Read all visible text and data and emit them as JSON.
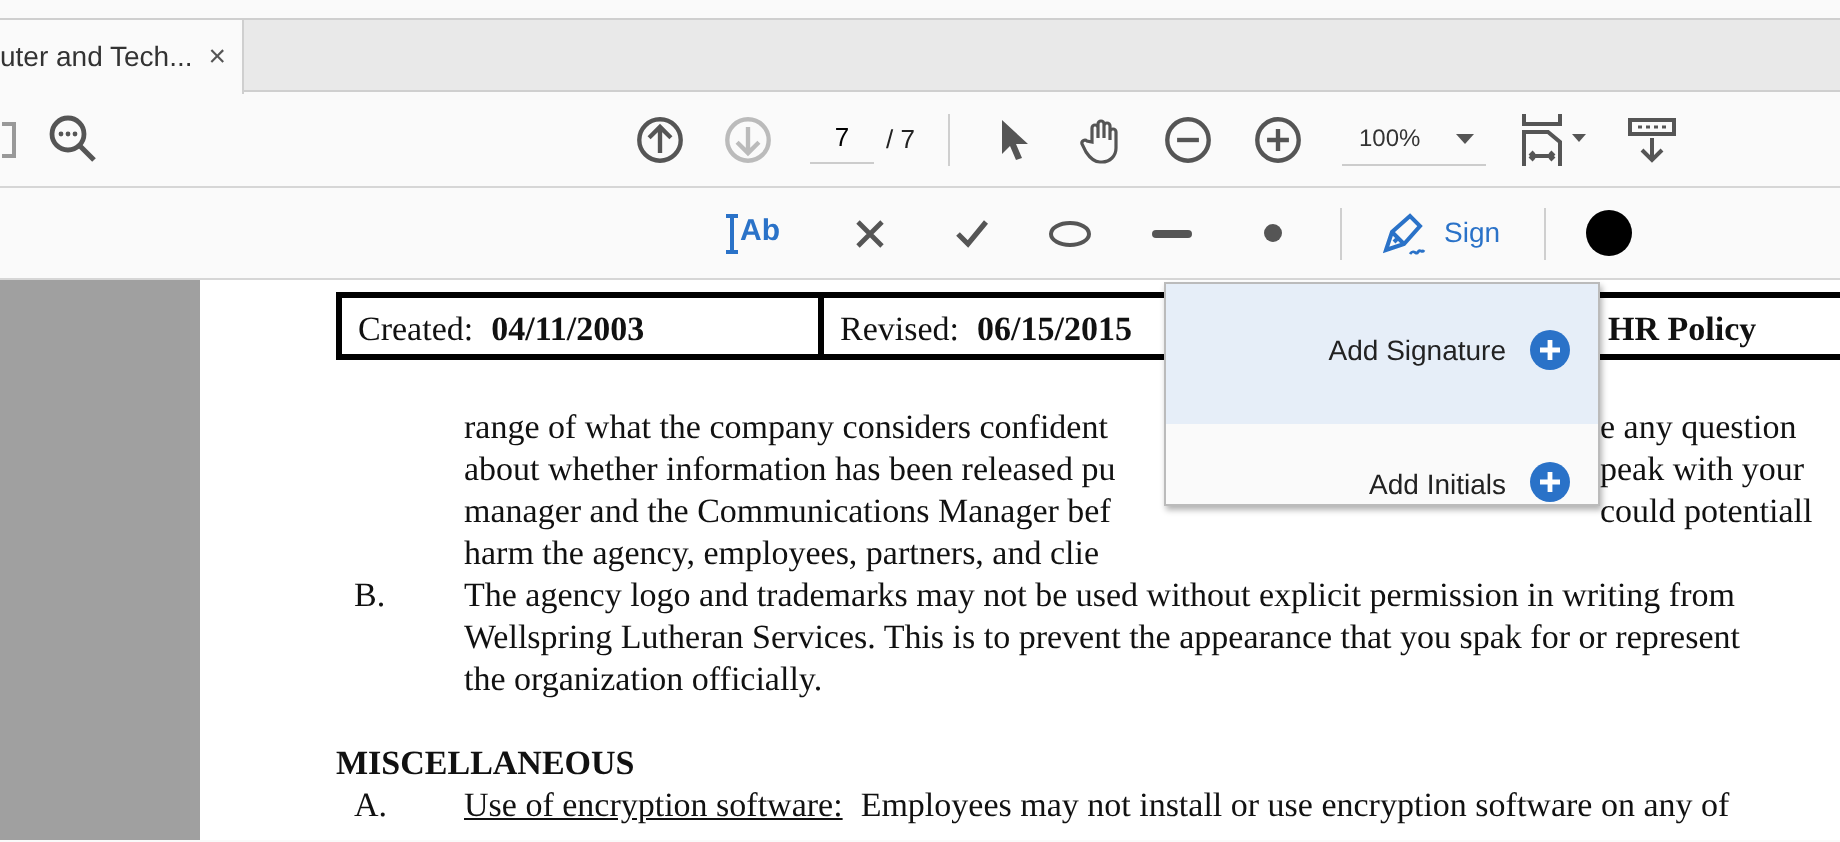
{
  "tab": {
    "title": "uter and Tech...",
    "close": "×"
  },
  "toolbar": {
    "nav_buttons": [
      {
        "kind": "previous",
        "disabled": false
      },
      {
        "kind": "next",
        "disabled": true
      }
    ],
    "page_current": "7",
    "page_total": "/ 7",
    "zoom": "100%"
  },
  "fill_sign_tools": [
    {
      "kind": "text",
      "label": "Ab"
    },
    {
      "kind": "cross"
    },
    {
      "kind": "check"
    },
    {
      "kind": "ellipse"
    },
    {
      "kind": "line"
    },
    {
      "kind": "dot"
    },
    {
      "kind": "sign",
      "label": "Sign"
    },
    {
      "kind": "color",
      "color": "#000000"
    }
  ],
  "document": {
    "header_row": [
      {
        "label": "Created:",
        "value": "04/11/2003"
      },
      {
        "label": "Revised:",
        "value": "06/15/2015"
      },
      {
        "label": "HR Policy"
      }
    ],
    "lines": [
      {
        "kind": "split",
        "left": "range of what the company considers confident",
        "right": "e any question"
      },
      {
        "kind": "split",
        "left": "about whether information has been released pu",
        "right": "peak with your"
      },
      {
        "kind": "split",
        "left": "manager and the Communications Manager bef",
        "right": "could potentiall"
      },
      {
        "kind": "split",
        "left": "harm the agency, employees, partners, and clie"
      },
      {
        "kind": "item",
        "marker": "B.",
        "text": "The agency logo and trademarks may not be used without explicit permission in writing from"
      },
      {
        "kind": "cont",
        "text": "Wellspring Lutheran Services. This is to prevent the appearance that you spak for or represent"
      },
      {
        "kind": "cont",
        "text": "the organization officially."
      },
      {
        "kind": "heading",
        "text": "MISCELLANEOUS"
      },
      {
        "kind": "item",
        "marker": "A.",
        "underlined": "Use of encryption software:",
        "text": "Employees may not install or use encryption software on any of"
      }
    ]
  },
  "sign_menu": [
    {
      "label": "Add Signature",
      "selected": true
    },
    {
      "label": "Add Initials",
      "selected": false
    }
  ]
}
